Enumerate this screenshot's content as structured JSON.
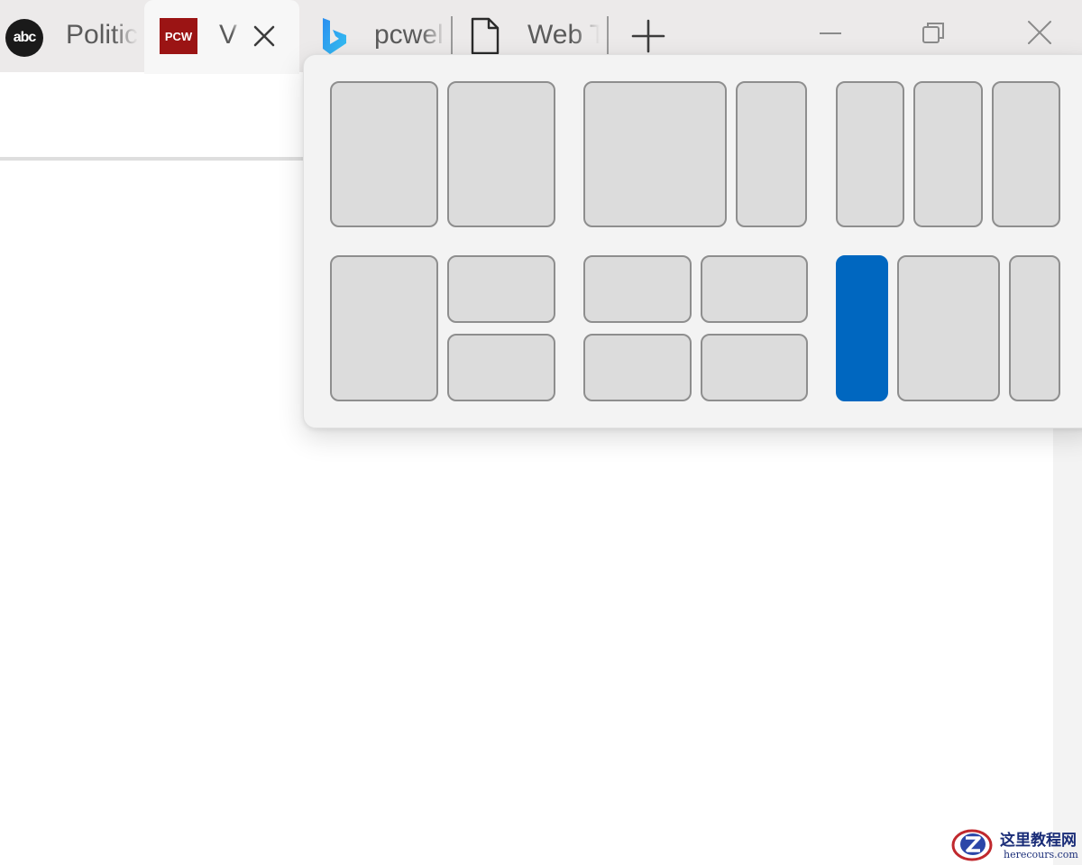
{
  "tabs": [
    {
      "favicon_text": "abc",
      "title": "Politic",
      "active": false
    },
    {
      "favicon_text": "PCW",
      "title": "V",
      "active": true
    },
    {
      "favicon_text": "",
      "title": "pcwel",
      "active": false
    },
    {
      "favicon_text": "",
      "title": "Web T",
      "active": false
    }
  ],
  "icons": {
    "tab_close": "close-icon",
    "new_tab": "plus-icon",
    "minimize": "minimize-icon",
    "restore": "restore-icon",
    "close_window": "close-icon",
    "bing": "bing-icon",
    "document": "document-icon"
  },
  "snap_layouts": {
    "accent_color": "#0067c0",
    "zone_color": "#dcdcdc",
    "layouts": [
      {
        "name": "two-halves",
        "zones": 2
      },
      {
        "name": "two-thirds-left",
        "zones": 2
      },
      {
        "name": "three-columns",
        "zones": 3
      },
      {
        "name": "left-half-right-quarters",
        "zones": 3
      },
      {
        "name": "four-quarters",
        "zones": 4
      },
      {
        "name": "wide-center-three-columns",
        "zones": 3,
        "highlighted_zone": 1
      }
    ]
  },
  "watermark": {
    "title": "这里教程网",
    "subtitle": "herecours.com"
  }
}
